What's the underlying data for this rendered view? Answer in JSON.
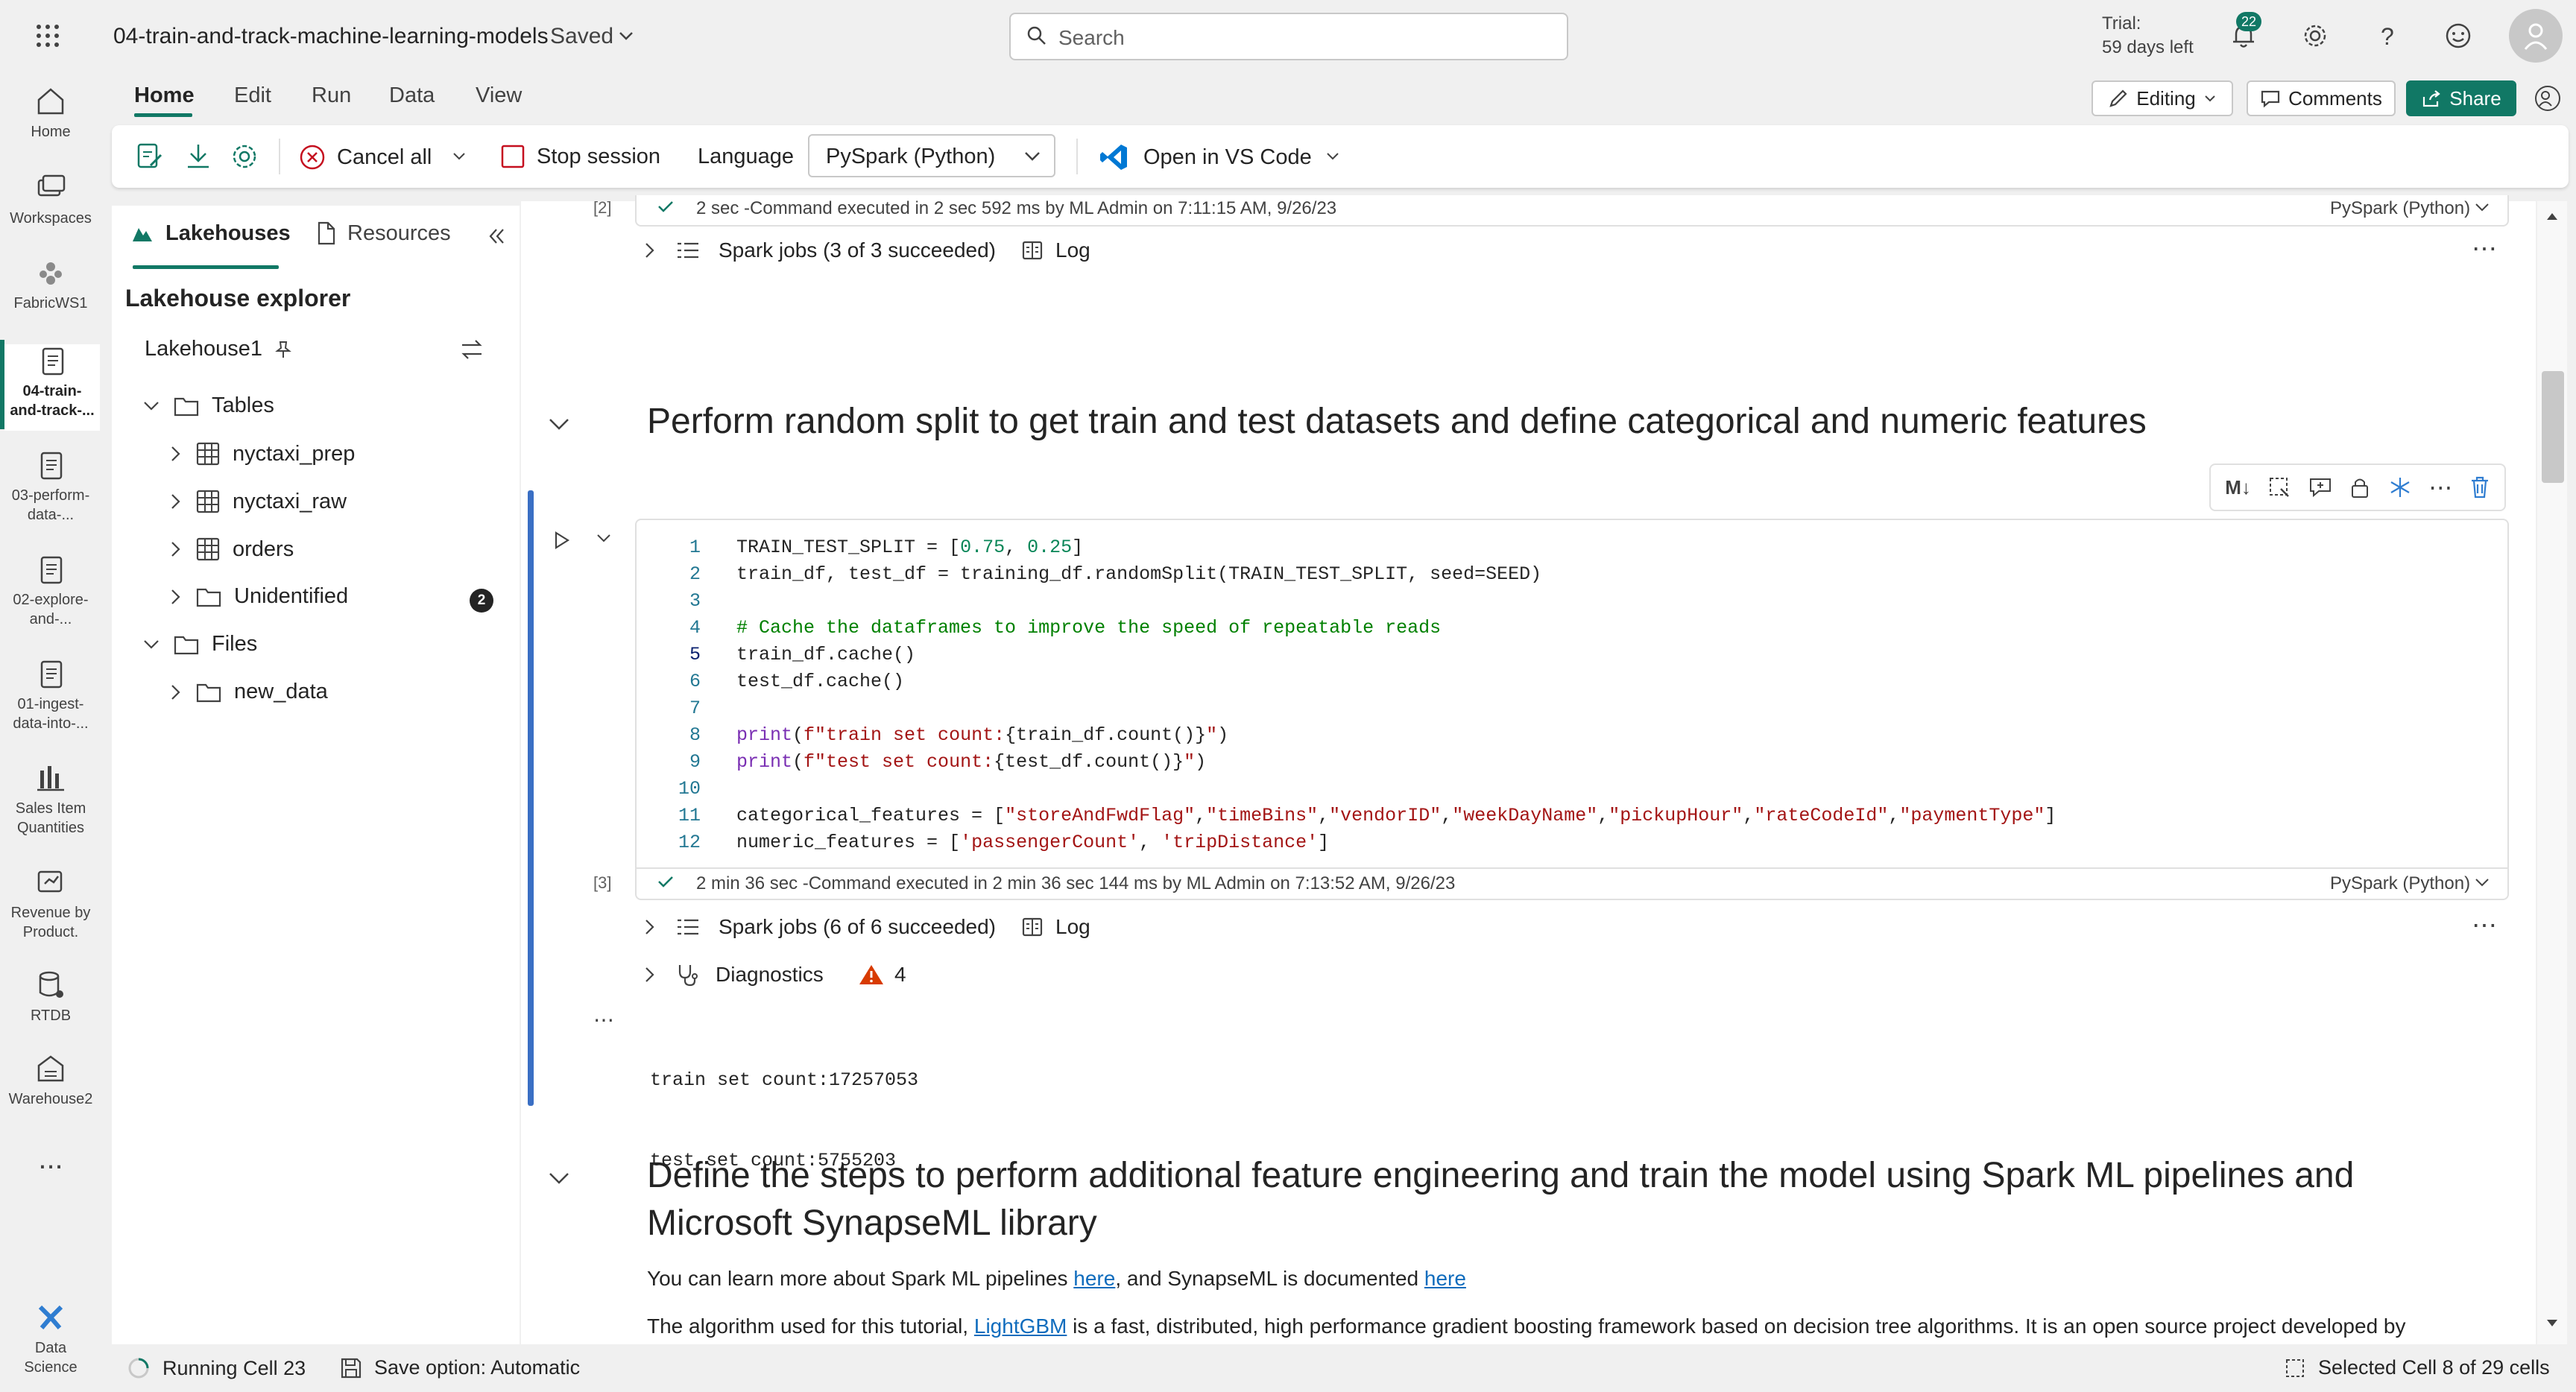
{
  "header": {
    "notebook_title": "04-train-and-track-machine-learning-models",
    "saved_label": "Saved",
    "search_placeholder": "Search",
    "trial_line1": "Trial:",
    "trial_line2": "59 days left",
    "notification_count": "22"
  },
  "rail": {
    "items": [
      {
        "label": "Home"
      },
      {
        "label": "Workspaces"
      },
      {
        "label": "FabricWS1"
      },
      {
        "label": "04-train-and-track-..."
      },
      {
        "label": "03-perform-data-..."
      },
      {
        "label": "02-explore-and-..."
      },
      {
        "label": "01-ingest-data-into-..."
      },
      {
        "label": "Sales Item Quantities"
      },
      {
        "label": "Revenue by Product."
      },
      {
        "label": "RTDB"
      },
      {
        "label": "Warehouse2"
      }
    ],
    "more_label": "...",
    "bottom_label": "Data Science"
  },
  "menu_tabs": [
    "Home",
    "Edit",
    "Run",
    "Data",
    "View"
  ],
  "header_actions": {
    "editing": "Editing",
    "comments": "Comments",
    "share": "Share"
  },
  "ribbon": {
    "cancel_all": "Cancel all",
    "stop_session": "Stop session",
    "language_label": "Language",
    "language_value": "PySpark (Python)",
    "open_vscode": "Open in VS Code"
  },
  "explorer": {
    "tab_lakehouses": "Lakehouses",
    "tab_resources": "Resources",
    "title": "Lakehouse explorer",
    "lakehouse_name": "Lakehouse1",
    "tables_label": "Tables",
    "tables": [
      "nyctaxi_prep",
      "nyctaxi_raw",
      "orders"
    ],
    "unidentified_label": "Unidentified",
    "unidentified_count": "2",
    "files_label": "Files",
    "files": [
      "new_data"
    ]
  },
  "cell2": {
    "exec_index": "[2]",
    "exec_info": "2 sec -Command executed in 2 sec 592 ms by ML Admin on 7:11:15 AM, 9/26/23",
    "language": "PySpark (Python)",
    "spark_jobs": "Spark jobs (3 of 3 succeeded)",
    "log": "Log"
  },
  "markdown1": {
    "heading": "Perform random split to get train and test datasets and define categorical and numeric features"
  },
  "cell3": {
    "toolbar_ml": "M↓",
    "line_numbers": [
      "1",
      "2",
      "3",
      "4",
      "5",
      "6",
      "7",
      "8",
      "9",
      "10",
      "11",
      "12"
    ],
    "exec_index": "[3]",
    "exec_info": "2 min 36 sec -Command executed in 2 min 36 sec 144 ms by ML Admin on 7:13:52 AM, 9/26/23",
    "language": "PySpark (Python)",
    "spark_jobs": "Spark jobs (6 of 6 succeeded)",
    "log": "Log",
    "diagnostics": "Diagnostics",
    "diagnostics_count": "4",
    "output_lines": [
      "train set count:17257053",
      "test set count:5755203"
    ]
  },
  "markdown2": {
    "heading_line1": "Define the steps to perform additional feature engineering and train the model using Spark ML pipelines and",
    "heading_line2": "Microsoft SynapseML library",
    "para1_a": "You can learn more about Spark ML pipelines ",
    "para1_link1": "here",
    "para1_b": ", and SynapseML is documented ",
    "para1_link2": "here",
    "para2_a": "The algorithm used for this tutorial, ",
    "para2_link": "LightGBM",
    "para2_b": " is a fast, distributed, high performance gradient boosting framework based on decision tree algorithms. It is an open source project developed by"
  },
  "status": {
    "running": "Running Cell 23",
    "save_option": "Save option: Automatic",
    "selected": "Selected Cell 8 of 29 cells"
  },
  "colors": {
    "accent_green": "#117865",
    "vscode_blue": "#0078d4",
    "cancel_red": "#c50f1f",
    "cell_selected_bar": "#3a6fc4",
    "warning_orange": "#d83b01"
  }
}
